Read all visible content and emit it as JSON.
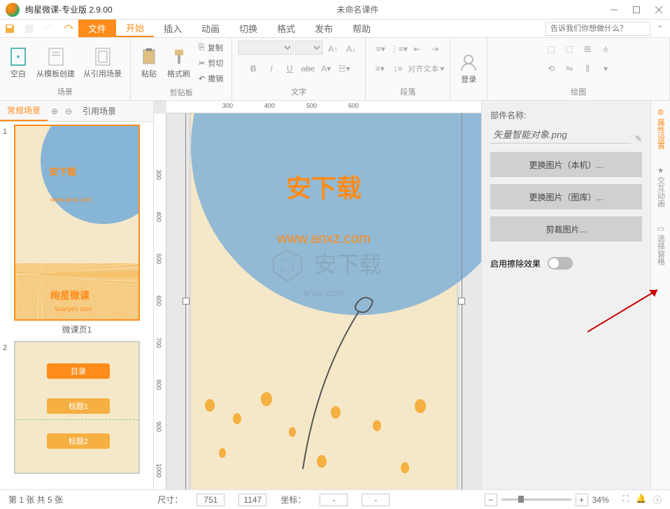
{
  "titlebar": {
    "app_title": "绚星微课-专业版 2.9.00",
    "doc_title": "未命名课件"
  },
  "tabs": {
    "file": "文件",
    "start": "开始",
    "insert": "插入",
    "animation": "动画",
    "transition": "切换",
    "format": "格式",
    "publish": "发布",
    "help": "帮助"
  },
  "search_placeholder": "告诉我们你想做什么？",
  "ribbon": {
    "blank": "空白",
    "from_template": "从模板创建",
    "from_reference": "从引用场景",
    "scene_group": "场景",
    "paste": "粘贴",
    "format_painter": "格式刷",
    "copy": "复制",
    "cut": "剪切",
    "undo": "撤销",
    "clipboard_group": "剪贴板",
    "text_group": "文字",
    "align_text": "对齐文本",
    "paragraph_group": "段落",
    "login": "登录",
    "draw_group": "绘图"
  },
  "scene_tabs": {
    "normal": "常规场景",
    "reference": "引用场景"
  },
  "slides": [
    {
      "num": "1",
      "title": "微课页1",
      "heading": "安下载",
      "url": "www.anxz.com",
      "brand": "绚星微课",
      "brand_url": "xuanyes.com"
    },
    {
      "num": "2",
      "menu1": "目录",
      "menu2": "标题1",
      "menu3": "标题2"
    }
  ],
  "canvas": {
    "heading": "安下载",
    "url": "www.anxz.com",
    "watermark": "安下载",
    "brand_url": "anxz.com"
  },
  "rulers_h": [
    "300",
    "400",
    "500",
    "600"
  ],
  "rulers_v": [
    "300",
    "400",
    "500",
    "600",
    "700",
    "800",
    "900",
    "1000"
  ],
  "props": {
    "name_label": "部件名称:",
    "name_value": "矢量智能对象.png",
    "change_local": "更换图片（本机）...",
    "change_library": "更换图片（图库）...",
    "crop": "剪裁图片...",
    "erase_effect": "启用擦除效果"
  },
  "side_tabs": {
    "props": "属性设置",
    "anim": "交互动画",
    "select": "选择窗格"
  },
  "statusbar": {
    "page_info": "第 1 张  共 5 张",
    "size_label": "尺寸：",
    "width": "751",
    "height": "1147",
    "coord_label": "坐标：",
    "x": "-",
    "y": "-",
    "zoom": "34%"
  }
}
